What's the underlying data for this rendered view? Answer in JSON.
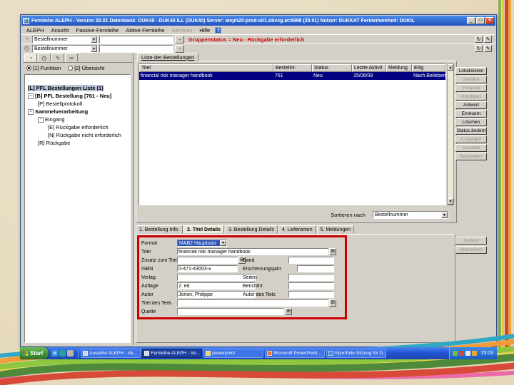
{
  "window": {
    "title": "Fernleihe ALEPH - Version 20.01  Datenbank: DUK40 - DUK40 ILL (DUK40)  Server: aleph20-prod-sh1.obvsg.at:6998 (20.01)  Nutzer: DUKKAT  Fernleiheinheit: DUKIL",
    "controls": {
      "minimize": "_",
      "maximize": "□",
      "close": "×"
    }
  },
  "menu": {
    "items": [
      {
        "label": "ALEPH",
        "enabled": true
      },
      {
        "label": "Ansicht",
        "enabled": true
      },
      {
        "label": "Passive-Fernleihe",
        "enabled": true
      },
      {
        "label": "Aktive-Fernleihe",
        "enabled": true
      },
      {
        "label": "Services",
        "enabled": false
      },
      {
        "label": "Hilfe",
        "enabled": true
      }
    ],
    "help_badge": "?"
  },
  "toolbar": {
    "row1": {
      "selector_value": "Bestellnummer",
      "input_value": "",
      "status_text": "Gruppenstatus = Neu - Rückgabe erforderlich"
    },
    "row2": {
      "selector_value": "Bestellnummer",
      "input_value": ""
    }
  },
  "icons": {
    "go_arrow": "→",
    "refresh": "↻",
    "edit": "✎",
    "clock_quarter": "◔",
    "clock": "◷",
    "lightning": "ϟ",
    "binoculars": "∞",
    "dropdown_arrow": "▼",
    "scroll_up": "▲",
    "scroll_down": "▼",
    "expand_grid": "⊞",
    "tree_collapse": "-",
    "quick_ie": "e"
  },
  "sidebar": {
    "radios": [
      {
        "label": "[1] Funktion",
        "selected": true
      },
      {
        "label": "[2] Übersicht",
        "selected": false
      }
    ],
    "tree": [
      {
        "label": "[L] PFL Bestellungen Liste (1)"
      },
      {
        "label": "[B] PFL Bestellung [761 - Neu]"
      },
      {
        "label": "[P] Bestellprotokoll"
      },
      {
        "label": "Sammelverarbeitung"
      },
      {
        "label": "Eingang"
      },
      {
        "label": "[E] Rückgabe erforderlich"
      },
      {
        "label": "[N] Rückgabe nicht erforderlich"
      },
      {
        "label": "[R] Rückgabe"
      }
    ]
  },
  "list_pane": {
    "tab_label": "Liste der Bestellungen",
    "headers": [
      "Titel",
      "Bestellnr.",
      "Status",
      "Letzte Aktivit",
      "Meldung",
      "Eilig"
    ],
    "row": {
      "titel": "financial risk manager handbook",
      "bestellnr": "761",
      "status": "Neu",
      "letzte_aktivitaet": "15/06/09",
      "meldung": "",
      "eilig": "Nach Belieben"
    },
    "sort_label": "Sortieren nach",
    "sort_value": "Bestellnummer",
    "buttons": [
      {
        "label": "Lokalisieren",
        "enabled": true
      },
      {
        "label": "Senden",
        "enabled": false
      },
      {
        "label": "Eingang",
        "enabled": false
      },
      {
        "label": "Kündigen",
        "enabled": false
      },
      {
        "label": "Antwort",
        "enabled": true
      },
      {
        "label": "Erneuern",
        "enabled": true
      },
      {
        "label": "Löschen",
        "enabled": true
      },
      {
        "label": "Status ändern",
        "enabled": true
      },
      {
        "label": "Copyright",
        "enabled": false
      },
      {
        "label": "Ausleihe",
        "enabled": false
      },
      {
        "label": "Bearbeiten",
        "enabled": false
      }
    ]
  },
  "detail_pane": {
    "tabs": [
      {
        "label": "1. Bestellung Info.",
        "active": false
      },
      {
        "label": "2. Titel Details",
        "active": true
      },
      {
        "label": "3. Bestellung Details",
        "active": false
      },
      {
        "label": "4. Lieferanten",
        "active": false
      },
      {
        "label": "5. Meldungen",
        "active": false
      }
    ],
    "form": {
      "format_label": "Format",
      "format_value": "MAB2 Hauptsatz",
      "titel_label": "Titel",
      "titel_value": "financial risk manager handbook",
      "zusatz_label": "Zusatz zum Titel",
      "zusatz_value": "",
      "band_label": "Band",
      "band_value": "",
      "isbn_label": "ISBN",
      "isbn_value": "0-471-43003-x",
      "jahr_label": "Erscheinungsjahr",
      "jahr_value": "",
      "verlag_label": "Verlag",
      "verlag_value": "",
      "seiten_label": "Seiten",
      "seiten_value": "",
      "auflage_label": "Auflage",
      "auflage_value": "2. ed",
      "berichtnr_label": "Berichtnr.",
      "berichtnr_value": "",
      "autor_label": "Autor",
      "autor_value": "Jorion, Philippe",
      "autor_teil_label": "Autor des Teils",
      "autor_teil_value": "",
      "titel_teil_label": "Titel des Teils",
      "titel_teil_value": "",
      "quelle_label": "Quelle",
      "quelle_value": ""
    },
    "buttons": [
      {
        "label": "Ändern",
        "enabled": false
      },
      {
        "label": "Abbrechen",
        "enabled": false
      }
    ]
  },
  "taskbar": {
    "start_label": "Start",
    "tasks": [
      {
        "label": "Ausleihe ALEPH - Ve...",
        "active": false
      },
      {
        "label": "Fernleihe ALEPH - Ve...",
        "active": true
      },
      {
        "label": "powerpoint",
        "active": false
      },
      {
        "label": "Microsoft PowerPoint...",
        "active": false
      },
      {
        "label": "Eportfolio-Sitzung für D...",
        "active": false
      }
    ],
    "clock": "15:03"
  },
  "colors": {
    "annotation_red": "#cc0000",
    "status_red": "#cc0000",
    "selection_navy": "#000080",
    "titlebar_blue": "#2a5fd0",
    "taskbar_blue": "#2254d4",
    "start_green": "#3e8f33",
    "parchment": "#e8dcc2"
  }
}
